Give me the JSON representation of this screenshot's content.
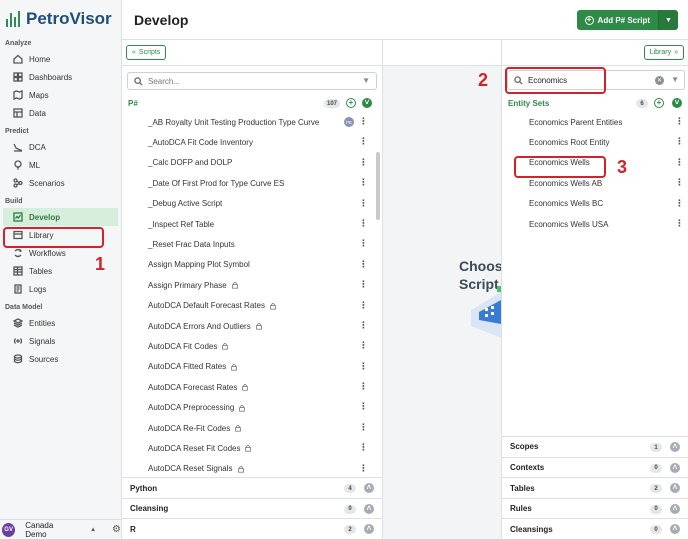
{
  "app": {
    "name": "PetroVisor"
  },
  "sidebar": {
    "sections": [
      {
        "title": "Analyze",
        "items": [
          {
            "label": "Home",
            "icon": "home-icon"
          },
          {
            "label": "Dashboards",
            "icon": "dashboard-icon"
          },
          {
            "label": "Maps",
            "icon": "map-icon"
          },
          {
            "label": "Data",
            "icon": "data-icon"
          }
        ]
      },
      {
        "title": "Predict",
        "items": [
          {
            "label": "DCA",
            "icon": "dca-icon"
          },
          {
            "label": "ML",
            "icon": "ml-icon"
          },
          {
            "label": "Scenarios",
            "icon": "scenarios-icon"
          }
        ]
      },
      {
        "title": "Build",
        "items": [
          {
            "label": "Develop",
            "icon": "develop-icon",
            "active": true
          },
          {
            "label": "Library",
            "icon": "library-icon"
          },
          {
            "label": "Workflows",
            "icon": "workflows-icon"
          },
          {
            "label": "Tables",
            "icon": "tables-icon"
          },
          {
            "label": "Logs",
            "icon": "logs-icon"
          }
        ]
      },
      {
        "title": "Data Model",
        "items": [
          {
            "label": "Entities",
            "icon": "entities-icon"
          },
          {
            "label": "Signals",
            "icon": "signals-icon"
          },
          {
            "label": "Sources",
            "icon": "sources-icon"
          }
        ]
      }
    ],
    "footer": {
      "avatar": "GV",
      "workspace": "Canada Demo"
    }
  },
  "header": {
    "title": "Develop",
    "add_button": "Add P# Script"
  },
  "left": {
    "toggle_label": "Scripts",
    "search_placeholder": "Search...",
    "pscripts": {
      "title": "P#",
      "count": "107",
      "items": [
        {
          "label": "_AB Royalty Unit Testing Production Type Curve",
          "tag": "PE"
        },
        {
          "label": "_AutoDCA Fit Code Inventory"
        },
        {
          "label": "_Calc DOFP and DOLP"
        },
        {
          "label": "_Date Of First Prod for Type Curve ES"
        },
        {
          "label": "_Debug Active Script"
        },
        {
          "label": "_Inspect Ref Table"
        },
        {
          "label": "_Reset Frac Data Inputs"
        },
        {
          "label": "Assign Mapping Plot Symbol"
        },
        {
          "label": "Assign Primary Phase",
          "locked": true
        },
        {
          "label": "AutoDCA Default Forecast Rates",
          "locked": true
        },
        {
          "label": "AutoDCA Errors And Outliers",
          "locked": true
        },
        {
          "label": "AutoDCA Fit Codes",
          "locked": true
        },
        {
          "label": "AutoDCA Fitted Rates",
          "locked": true
        },
        {
          "label": "AutoDCA Forecast Rates",
          "locked": true
        },
        {
          "label": "AutoDCA Preprocessing",
          "locked": true
        },
        {
          "label": "AutoDCA Re-Fit Codes",
          "locked": true
        },
        {
          "label": "AutoDCA Reset Fit Codes",
          "locked": true
        },
        {
          "label": "AutoDCA Reset Signals",
          "locked": true
        }
      ]
    },
    "collapsed": [
      {
        "title": "Python",
        "count": "4"
      },
      {
        "title": "Cleansing",
        "count": "0"
      },
      {
        "title": "R",
        "count": "2"
      }
    ]
  },
  "center": {
    "placeholder_line1": "Choos",
    "placeholder_line2": "Script"
  },
  "right": {
    "toggle_label": "Library",
    "search_value": "Economics",
    "entity_sets": {
      "title": "Entity Sets",
      "count": "6",
      "items": [
        {
          "label": "Economics Parent Entities"
        },
        {
          "label": "Economics Root Entity"
        },
        {
          "label": "Economics Wells"
        },
        {
          "label": "Economics Wells AB"
        },
        {
          "label": "Economics Wells BC"
        },
        {
          "label": "Economics Wells USA"
        }
      ]
    },
    "collapsed": [
      {
        "title": "Scopes",
        "count": "1"
      },
      {
        "title": "Contexts",
        "count": "0"
      },
      {
        "title": "Tables",
        "count": "2"
      },
      {
        "title": "Rules",
        "count": "0"
      },
      {
        "title": "Cleansings",
        "count": "0"
      }
    ]
  },
  "annotations": {
    "one": "1",
    "two": "2",
    "three": "3"
  },
  "colors": {
    "accent": "#2e8b47",
    "annotation": "#d3222a",
    "active_bg": "#d7eedc"
  }
}
